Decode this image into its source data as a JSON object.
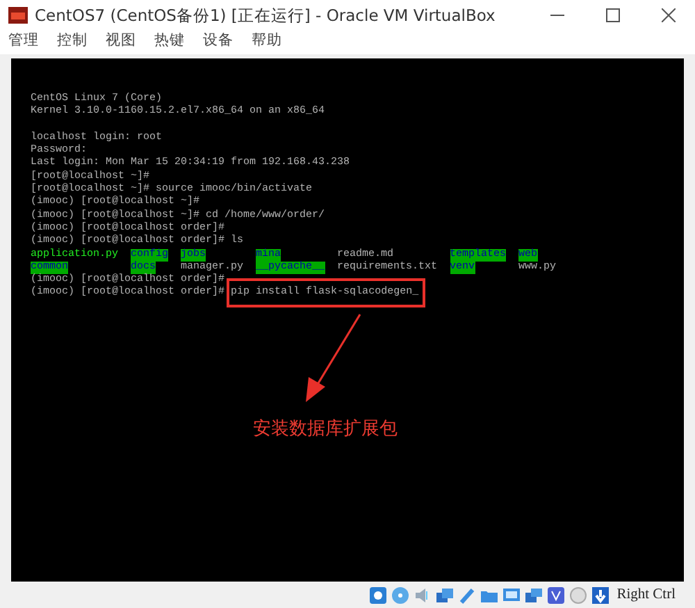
{
  "window": {
    "title": "CentOS7 (CentOS备份1) [正在运行] - Oracle VM VirtualBox"
  },
  "menu": [
    "管理",
    "控制",
    "视图",
    "热键",
    "设备",
    "帮助"
  ],
  "terminal": {
    "header": [
      "CentOS Linux 7 (Core)",
      "Kernel 3.10.0-1160.15.2.el7.x86_64 on an x86_64"
    ],
    "session": [
      "localhost login: root",
      "Password:",
      "Last login: Mon Mar 15 20:34:19 from 192.168.43.238",
      "[root@localhost ~]#",
      "[root@localhost ~]# source imooc/bin/activate",
      "(imooc) [root@localhost ~]#",
      "(imooc) [root@localhost ~]# cd /home/www/order/",
      "(imooc) [root@localhost order]#",
      "(imooc) [root@localhost order]# ls"
    ],
    "listing": [
      [
        {
          "name": "application.py",
          "kind": "exec"
        },
        {
          "name": "config",
          "kind": "dir"
        },
        {
          "name": "jobs",
          "kind": "dir"
        },
        {
          "name": "mina",
          "kind": "dir"
        },
        {
          "name": "readme.md",
          "kind": "file"
        },
        {
          "name": "templates",
          "kind": "dir"
        },
        {
          "name": "web",
          "kind": "dir"
        }
      ],
      [
        {
          "name": "common",
          "kind": "dir"
        },
        {
          "name": "docs",
          "kind": "dir"
        },
        {
          "name": "manager.py",
          "kind": "file"
        },
        {
          "name": "__pycache__",
          "kind": "dir"
        },
        {
          "name": "requirements.txt",
          "kind": "file"
        },
        {
          "name": "venv",
          "kind": "dir"
        },
        {
          "name": "www.py",
          "kind": "file"
        }
      ]
    ],
    "after": [
      "(imooc) [root@localhost order]#"
    ],
    "prompt": "(imooc) [root@localhost order]#",
    "command": "pip install flask-sqlacodegen_"
  },
  "annotation": {
    "label": "安装数据库扩展包"
  },
  "status_bar": {
    "host_key": "Right Ctrl"
  }
}
